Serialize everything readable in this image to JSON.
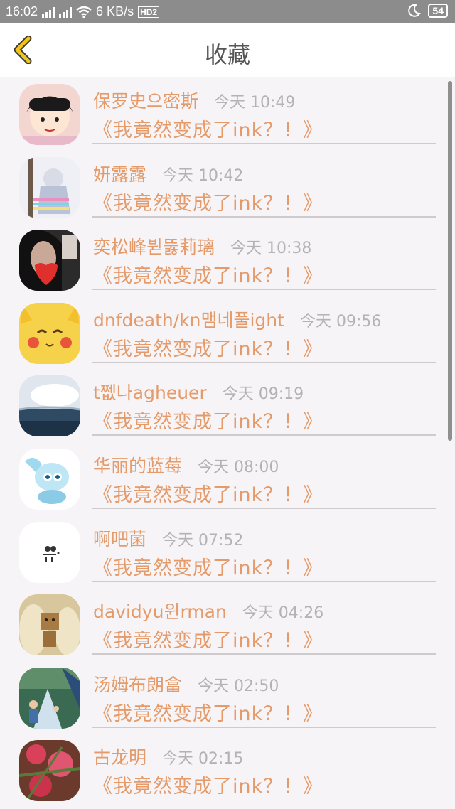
{
  "status_bar": {
    "time": "16:02",
    "net_2g": "2G",
    "net_4g": "4G",
    "speed": "6 KB/s",
    "hd_badge": "HD2",
    "battery": "54"
  },
  "header": {
    "title": "收藏"
  },
  "items": [
    {
      "name": "保罗史으密斯",
      "time": "今天 10:49",
      "message": "《我竟然变成了ink？！》"
    },
    {
      "name": "妍露露",
      "time": "今天 10:42",
      "message": "《我竟然变成了ink？！》"
    },
    {
      "name": "奕松峰뷛뚫莉璃",
      "time": "今天 10:38",
      "message": "《我竟然变成了ink？！》"
    },
    {
      "name": "dnfdeath/kn맴네풀ight",
      "time": "今天 09:56",
      "message": "《我竟然变成了ink？！》"
    },
    {
      "name": "t쩺나agheuer",
      "time": "今天 09:19",
      "message": "《我竟然变成了ink？！》"
    },
    {
      "name": "华丽的蓝莓",
      "time": "今天 08:00",
      "message": "《我竟然变成了ink？！》"
    },
    {
      "name": "啊吧菌",
      "time": "今天 07:52",
      "message": "《我竟然变成了ink？！》"
    },
    {
      "name": "davidyu윈rman",
      "time": "今天 04:26",
      "message": "《我竟然变成了ink？！》"
    },
    {
      "name": "汤姆布朗畣",
      "time": "今天 02:50",
      "message": "《我竟然变成了ink？！》"
    },
    {
      "name": "古龙明",
      "time": "今天 02:15",
      "message": "《我竟然变成了ink？！》"
    }
  ],
  "colors": {
    "accent": "#e59a6a",
    "time_gray": "#b7b1b3",
    "back_arrow": "#f0c419"
  }
}
